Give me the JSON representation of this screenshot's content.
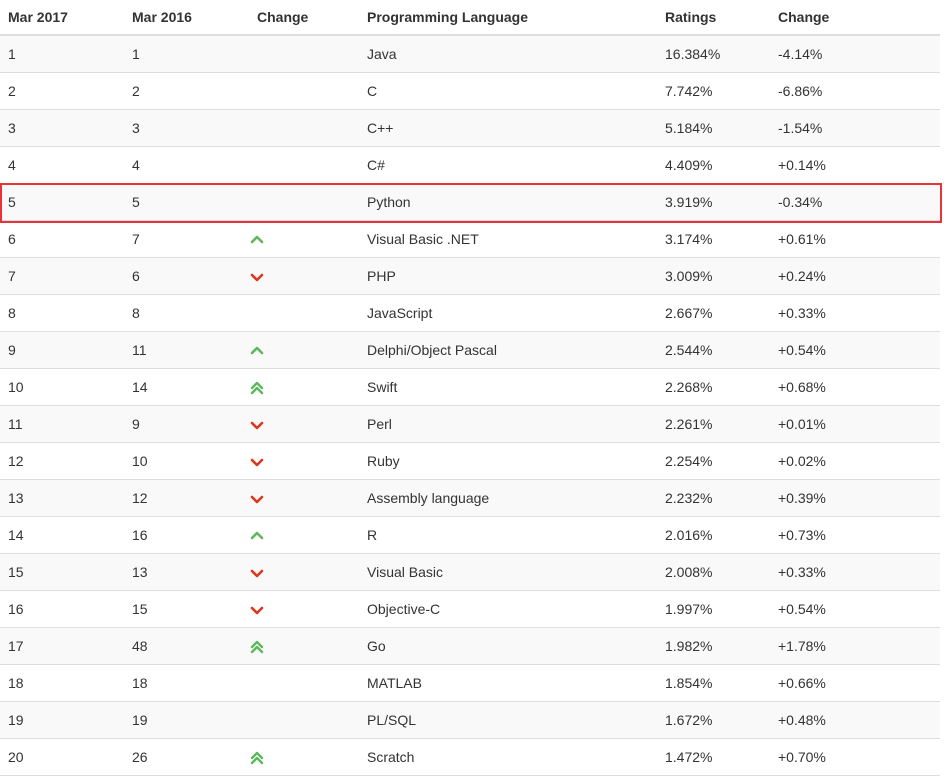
{
  "header": {
    "col_mar2017": "Mar 2017",
    "col_mar2016": "Mar 2016",
    "col_change": "Change",
    "col_language": "Programming Language",
    "col_ratings": "Ratings",
    "col_ratings_change": "Change"
  },
  "highlight_color": "#e8333a",
  "arrow_colors": {
    "up": "#5cb85c",
    "down": "#d9381e"
  },
  "rows": [
    {
      "r2017": "1",
      "r2016": "1",
      "trend": "none",
      "lang": "Java",
      "rating": "16.384%",
      "change": "-4.14%"
    },
    {
      "r2017": "2",
      "r2016": "2",
      "trend": "none",
      "lang": "C",
      "rating": "7.742%",
      "change": "-6.86%"
    },
    {
      "r2017": "3",
      "r2016": "3",
      "trend": "none",
      "lang": "C++",
      "rating": "5.184%",
      "change": "-1.54%"
    },
    {
      "r2017": "4",
      "r2016": "4",
      "trend": "none",
      "lang": "C#",
      "rating": "4.409%",
      "change": "+0.14%"
    },
    {
      "r2017": "5",
      "r2016": "5",
      "trend": "none",
      "lang": "Python",
      "rating": "3.919%",
      "change": "-0.34%",
      "highlighted": true
    },
    {
      "r2017": "6",
      "r2016": "7",
      "trend": "up",
      "lang": "Visual Basic .NET",
      "rating": "3.174%",
      "change": "+0.61%"
    },
    {
      "r2017": "7",
      "r2016": "6",
      "trend": "down",
      "lang": "PHP",
      "rating": "3.009%",
      "change": "+0.24%"
    },
    {
      "r2017": "8",
      "r2016": "8",
      "trend": "none",
      "lang": "JavaScript",
      "rating": "2.667%",
      "change": "+0.33%"
    },
    {
      "r2017": "9",
      "r2016": "11",
      "trend": "up",
      "lang": "Delphi/Object Pascal",
      "rating": "2.544%",
      "change": "+0.54%"
    },
    {
      "r2017": "10",
      "r2016": "14",
      "trend": "double-up",
      "lang": "Swift",
      "rating": "2.268%",
      "change": "+0.68%"
    },
    {
      "r2017": "11",
      "r2016": "9",
      "trend": "down",
      "lang": "Perl",
      "rating": "2.261%",
      "change": "+0.01%"
    },
    {
      "r2017": "12",
      "r2016": "10",
      "trend": "down",
      "lang": "Ruby",
      "rating": "2.254%",
      "change": "+0.02%"
    },
    {
      "r2017": "13",
      "r2016": "12",
      "trend": "down",
      "lang": "Assembly language",
      "rating": "2.232%",
      "change": "+0.39%"
    },
    {
      "r2017": "14",
      "r2016": "16",
      "trend": "up",
      "lang": "R",
      "rating": "2.016%",
      "change": "+0.73%"
    },
    {
      "r2017": "15",
      "r2016": "13",
      "trend": "down",
      "lang": "Visual Basic",
      "rating": "2.008%",
      "change": "+0.33%"
    },
    {
      "r2017": "16",
      "r2016": "15",
      "trend": "down",
      "lang": "Objective-C",
      "rating": "1.997%",
      "change": "+0.54%"
    },
    {
      "r2017": "17",
      "r2016": "48",
      "trend": "double-up",
      "lang": "Go",
      "rating": "1.982%",
      "change": "+1.78%"
    },
    {
      "r2017": "18",
      "r2016": "18",
      "trend": "none",
      "lang": "MATLAB",
      "rating": "1.854%",
      "change": "+0.66%"
    },
    {
      "r2017": "19",
      "r2016": "19",
      "trend": "none",
      "lang": "PL/SQL",
      "rating": "1.672%",
      "change": "+0.48%"
    },
    {
      "r2017": "20",
      "r2016": "26",
      "trend": "double-up",
      "lang": "Scratch",
      "rating": "1.472%",
      "change": "+0.70%"
    }
  ]
}
